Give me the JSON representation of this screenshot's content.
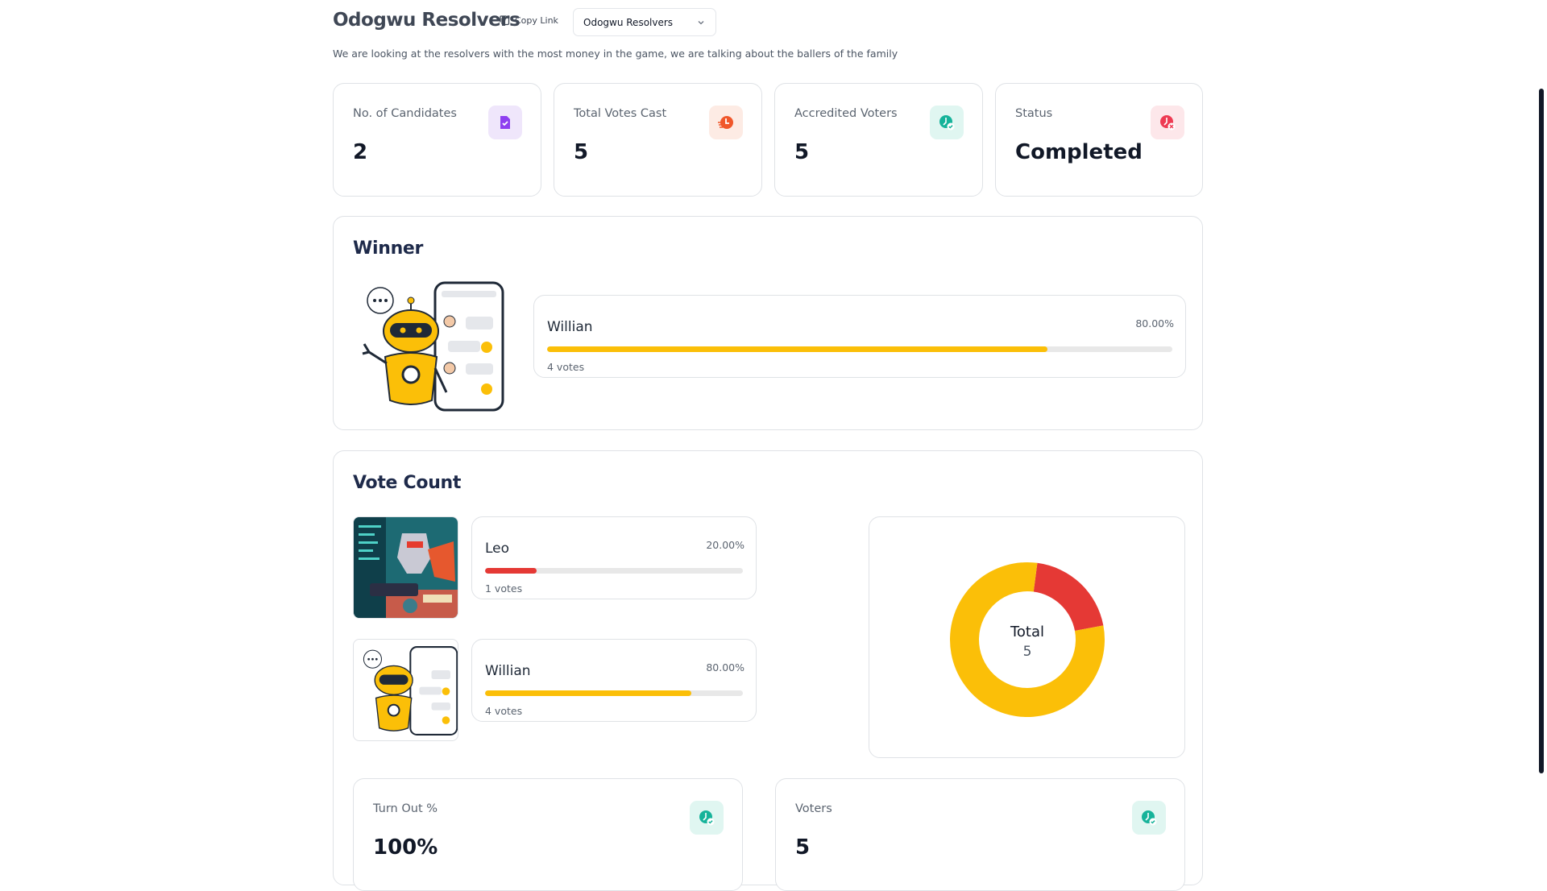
{
  "header": {
    "title": "Odogwu Resolvers",
    "copy_label": "Copy Link",
    "selected_election": "Odogwu Resolvers",
    "description": "We are looking at the resolvers with the most money in the game, we are talking about the ballers of the family"
  },
  "stats": [
    {
      "label": "No. of Candidates",
      "value": "2",
      "icon": "document-check-icon"
    },
    {
      "label": "Total Votes Cast",
      "value": "5",
      "icon": "ballot-icon"
    },
    {
      "label": "Accredited Voters",
      "value": "5",
      "icon": "accredited-icon"
    },
    {
      "label": "Status",
      "value": "Completed",
      "icon": "status-closed-icon"
    }
  ],
  "winner": {
    "heading": "Winner",
    "name": "Willian",
    "percent": "80.00%",
    "fraction": 0.8,
    "votes": "4 votes"
  },
  "vote_count": {
    "heading": "Vote Count",
    "candidates": [
      {
        "name": "Leo",
        "percent": "20.00%",
        "fraction": 0.2,
        "votes": "1 votes",
        "color": "#e53935"
      },
      {
        "name": "Willian",
        "percent": "80.00%",
        "fraction": 0.8,
        "votes": "4 votes",
        "color": "#fbbf08"
      }
    ],
    "donut": {
      "center_label": "Total",
      "center_value": "5"
    }
  },
  "chart_data": {
    "type": "pie",
    "categories": [
      "Leo",
      "Willian"
    ],
    "values": [
      1,
      4
    ],
    "colors": [
      "#e53935",
      "#fbbf08"
    ],
    "title": "",
    "center_label": "Total",
    "center_value": 5
  },
  "bottom_stats": [
    {
      "label": "Turn Out %",
      "value": "100%",
      "icon": "accredited-icon"
    },
    {
      "label": "Voters",
      "value": "5",
      "icon": "accredited-icon"
    }
  ],
  "colors": {
    "accent": "#fbbf08",
    "danger": "#e53935",
    "heading": "#1e2a4a"
  }
}
